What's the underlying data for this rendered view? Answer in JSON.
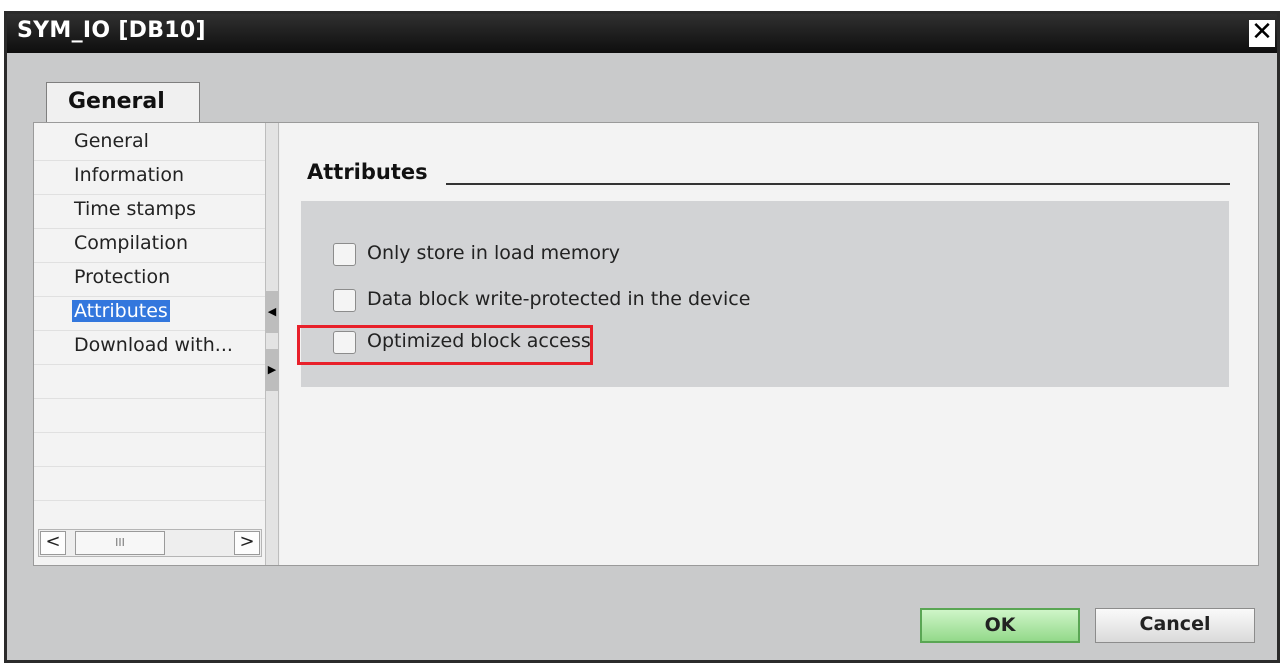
{
  "window": {
    "title": "SYM_IO [DB10]",
    "close_glyph": "✕"
  },
  "tab": {
    "label": "General"
  },
  "nav": {
    "items": [
      {
        "label": "General"
      },
      {
        "label": "Information"
      },
      {
        "label": "Time stamps"
      },
      {
        "label": "Compilation"
      },
      {
        "label": "Protection"
      },
      {
        "label": "Attributes",
        "selected": true
      },
      {
        "label": "Download with..."
      }
    ]
  },
  "splitter": {
    "collapse_glyph": "◀",
    "expand_glyph": "▶"
  },
  "scrollbar": {
    "left_glyph": "<",
    "right_glyph": ">",
    "thumb_glyph": "III"
  },
  "section": {
    "title": "Attributes"
  },
  "options": [
    {
      "label": "Only store in load memory",
      "checked": false
    },
    {
      "label": "Data block write-protected in the device",
      "checked": false
    },
    {
      "label": "Optimized block access",
      "checked": false,
      "highlighted": true
    }
  ],
  "buttons": {
    "ok": "OK",
    "cancel": "Cancel"
  },
  "colors": {
    "selection": "#3377dd",
    "highlight_border": "#e8202a",
    "ok_button": "#93d98a"
  }
}
